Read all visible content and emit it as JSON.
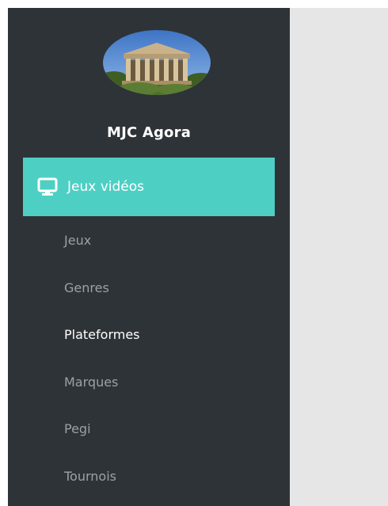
{
  "sidebar": {
    "brand": "MJC Agora",
    "avatar_icon": "temple-photo",
    "section": {
      "label": "Jeux vidéos",
      "icon": "monitor-icon",
      "color": "#4ecfc4"
    },
    "items": [
      {
        "label": "Jeux",
        "active": false
      },
      {
        "label": "Genres",
        "active": false
      },
      {
        "label": "Plateformes",
        "active": true
      },
      {
        "label": "Marques",
        "active": false
      },
      {
        "label": "Pegi",
        "active": false
      },
      {
        "label": "Tournois",
        "active": false
      }
    ]
  },
  "colors": {
    "sidebar_bg": "#2e3337",
    "main_bg": "#e6e6e6",
    "accent": "#4ecfc4",
    "muted_text": "#9ba1a5",
    "active_text": "#ffffff"
  }
}
